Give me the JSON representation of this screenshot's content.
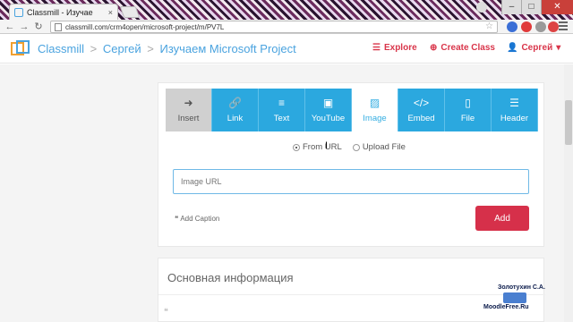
{
  "browser": {
    "tab_title": "Classmill - Изучае",
    "tab_close": "×",
    "url": "classmill.com/crm4open/microsoft-project/m/PV7L",
    "window_controls": [
      "–",
      "□",
      "✕"
    ]
  },
  "header": {
    "brand": "Classmill",
    "breadcrumbs": [
      "Сергей",
      "Изучаем Microsoft Project"
    ],
    "separator": ">",
    "explore_label": "Explore",
    "create_class_label": "Create Class",
    "user_label": "Сергей",
    "accent_color": "#d9354a",
    "brand_color": "#4aa3df"
  },
  "editor": {
    "tools": [
      {
        "label": "Insert",
        "icon": "arrow-right-icon",
        "glyph": "➜"
      },
      {
        "label": "Link",
        "icon": "link-icon",
        "glyph": "🔗"
      },
      {
        "label": "Text",
        "icon": "text-icon",
        "glyph": "≡"
      },
      {
        "label": "YouTube",
        "icon": "youtube-icon",
        "glyph": "▣"
      },
      {
        "label": "Image",
        "icon": "image-icon",
        "glyph": "▨"
      },
      {
        "label": "Embed",
        "icon": "code-icon",
        "glyph": "</>"
      },
      {
        "label": "File",
        "icon": "file-icon",
        "glyph": "▯"
      },
      {
        "label": "Header",
        "icon": "header-icon",
        "glyph": "☰"
      }
    ],
    "source_options": {
      "from_url": "From URL",
      "upload_file": "Upload File",
      "selected": "From URL"
    },
    "url_placeholder": "Image URL",
    "add_caption_label": "Add Caption",
    "add_caption_icon": "❝",
    "add_button_label": "Add"
  },
  "section": {
    "title": "Основная информация",
    "quote_icon": "❝"
  },
  "watermark": {
    "name": "Золотухин С.А.",
    "site": "MoodleFree.Ru"
  }
}
